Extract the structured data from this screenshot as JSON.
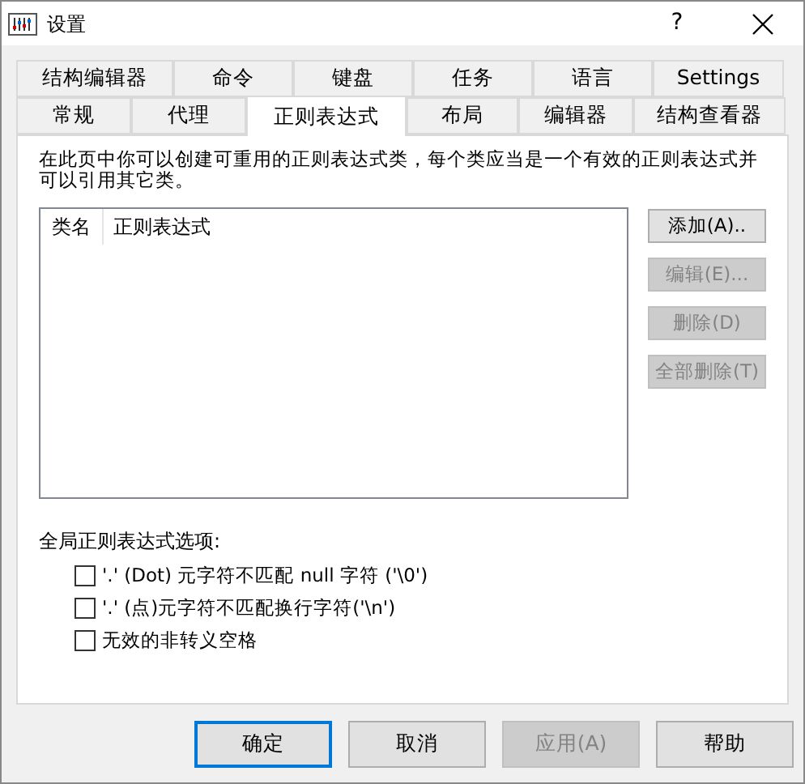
{
  "window": {
    "title": "设置",
    "help": "?"
  },
  "tab_rows": [
    [
      {
        "label": "结构编辑器",
        "selected": false
      },
      {
        "label": "命令",
        "selected": false
      },
      {
        "label": "键盘",
        "selected": false
      },
      {
        "label": "任务",
        "selected": false
      },
      {
        "label": "语言",
        "selected": false
      },
      {
        "label": "Settings",
        "selected": false
      }
    ],
    [
      {
        "label": "常规",
        "selected": false
      },
      {
        "label": "代理",
        "selected": false
      },
      {
        "label": "正则表达式",
        "selected": true
      },
      {
        "label": "布局",
        "selected": false
      },
      {
        "label": "编辑器",
        "selected": false
      },
      {
        "label": "结构查看器",
        "selected": false
      }
    ]
  ],
  "description": "在此页中你可以创建可重用的正则表达式类，每个类应当是一个有效的正则表达式并可以引用其它类。",
  "table": {
    "columns": [
      "类名",
      "正则表达式"
    ]
  },
  "side_buttons": [
    {
      "label": "添加(A)..",
      "disabled": false
    },
    {
      "label": "编辑(E)...",
      "disabled": true
    },
    {
      "label": "删除(D)",
      "disabled": true
    },
    {
      "label": "全部删除(T)",
      "disabled": true
    }
  ],
  "options_label": "全局正则表达式选项:",
  "options": [
    {
      "label": "'.' (Dot) 元字符不匹配 null 字符 ('\\0')",
      "checked": false
    },
    {
      "label": "'.' (点)元字符不匹配换行字符('\\n')",
      "checked": false
    },
    {
      "label": "无效的非转义空格",
      "checked": false
    }
  ],
  "buttons": [
    {
      "label": "确定",
      "default": true,
      "disabled": false
    },
    {
      "label": "取消",
      "default": false,
      "disabled": false
    },
    {
      "label": "应用(A)",
      "default": false,
      "disabled": true
    },
    {
      "label": "帮助",
      "default": false,
      "disabled": false
    }
  ]
}
